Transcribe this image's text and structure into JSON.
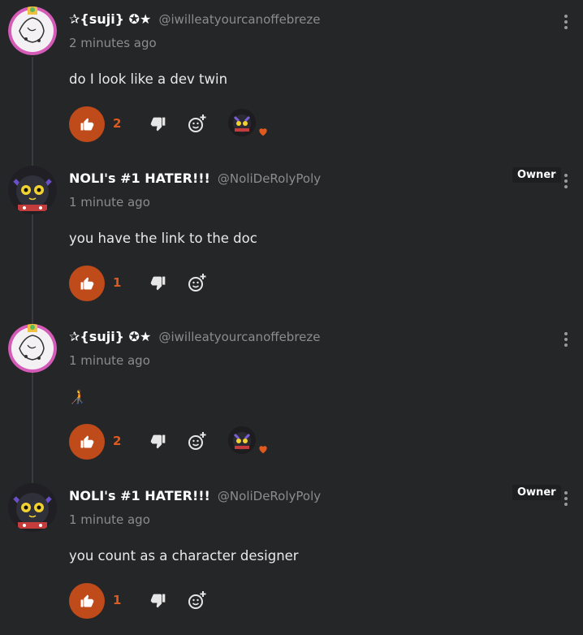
{
  "colors": {
    "background": "#252628",
    "accent": "#bf4a1a",
    "like_count": "#e0591f",
    "muted": "#8c8c8c"
  },
  "icons": [
    "thumbs-up-icon",
    "thumbs-down-icon",
    "add-emoji-icon",
    "more-vertical-icon",
    "heart-icon"
  ],
  "comments": [
    {
      "username": "✰{suji} ✪★",
      "handle": "@iwilleatyourcanoffebreze",
      "timestamp": "2 minutes ago",
      "text": "do I look like a dev twin",
      "likes": "2",
      "owner": ""
    },
    {
      "username": "NOLI's #1 HATER!!!",
      "handle": "@NoliDeRolyPoly",
      "timestamp": "1 minute ago",
      "text": "you have the link to the doc",
      "likes": "1",
      "owner": "Owner"
    },
    {
      "username": "✰{suji} ✪★",
      "handle": "@iwilleatyourcanoffebreze",
      "timestamp": "1 minute ago",
      "text": "🧑‍🦯",
      "likes": "2",
      "owner": ""
    },
    {
      "username": "NOLI's #1 HATER!!!",
      "handle": "@NoliDeRolyPoly",
      "timestamp": "1 minute ago",
      "text": "you count as a character designer",
      "likes": "1",
      "owner": "Owner"
    }
  ]
}
